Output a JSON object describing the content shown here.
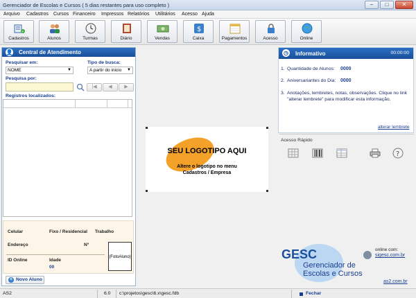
{
  "window": {
    "title": "Gerenciador de Escolas e Cursos  ( 5 dias restantes para uso completo )"
  },
  "menu": [
    "Arquivo",
    "Cadastros",
    "Cursos",
    "Financeiro",
    "Impressos",
    "Relatórios",
    "Utilitários",
    "Acesso",
    "Ajuda"
  ],
  "toolbar": [
    {
      "label": "Cadastros",
      "icon": "cadastros-icon"
    },
    {
      "label": "Alunos",
      "icon": "alunos-icon"
    },
    {
      "label": "Turmas",
      "icon": "clock-icon"
    },
    {
      "label": "Diário",
      "icon": "book-icon"
    },
    {
      "label": "Vendas",
      "icon": "money-icon"
    },
    {
      "label": "Caixa",
      "icon": "dollar-icon"
    },
    {
      "label": "Pagamentos",
      "icon": "calendar-icon"
    },
    {
      "label": "Acesso",
      "icon": "lock-icon"
    },
    {
      "label": "Online",
      "icon": "globe-icon"
    }
  ],
  "central": {
    "title": "Central de Atendimento",
    "search_in_label": "Pesquisar em:",
    "search_in_value": "NOME",
    "search_type_label": "Tipo de busca:",
    "search_type_value": "A partir do inicio",
    "search_by_label": "Pesquisa por:",
    "records_label": "Registros localizados:",
    "celular": "Celular",
    "fixo": "Fixo / Residencial",
    "trabalho": "Trabalho",
    "endereco": "Endereço",
    "numero": "Nº",
    "id_online": "ID Online",
    "idade": "Idade",
    "idade_value": "00",
    "photo": "(FotoAluno)",
    "new_button": "Novo Aluno"
  },
  "logo": {
    "main": "SEU LOGOTIPO AQUI",
    "line1": "Altere o logotipo no menu",
    "line2": "Cadastros / Empresa"
  },
  "informativo": {
    "title": "Informativo",
    "time": "00:00:00",
    "items": [
      {
        "n": "1.",
        "label": "Quantidade de Alunos:",
        "value": "0000"
      },
      {
        "n": "2.",
        "label": "Aniversariantes do Dia:",
        "value": "0000"
      }
    ],
    "note_n": "3.",
    "note": "Anotações, lembretes, notas, observações. Clique no link \"alterar lembrete\" para modificar esta informação.",
    "alter_link": "alterar lembrete",
    "quick_access": "Acesso Rápido",
    "quick_icons": [
      "grid-icon",
      "barcode-icon",
      "table-icon",
      "printer-icon",
      "help-icon"
    ]
  },
  "brand": {
    "name": "GESC",
    "line1": "Gerenciador de",
    "line2": "Escolas e Cursos",
    "online_label": "online com:",
    "online_url": "sigesc.com.br",
    "site": "as2.com.br"
  },
  "status": {
    "user": "AS2",
    "version": "6.0",
    "path": "c:\\projetos\\gesc\\6.x\\gesc.fdb",
    "close": "Fechar"
  },
  "colors": {
    "accent": "#1a4f9c",
    "link": "#1a3e8f",
    "logo_orange": "#f4a12a"
  }
}
